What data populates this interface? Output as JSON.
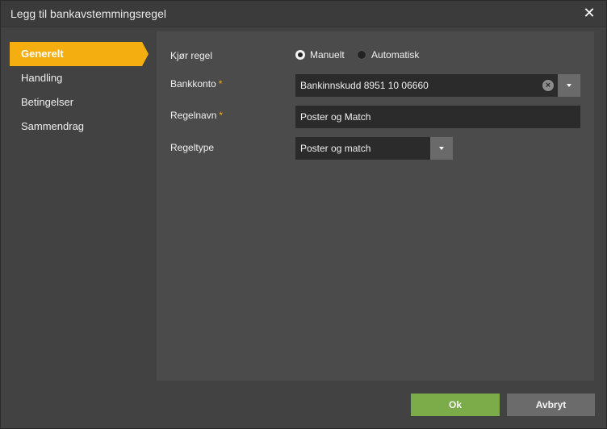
{
  "dialog": {
    "title": "Legg til bankavstemmingsregel",
    "close_glyph": "✕"
  },
  "sidebar": {
    "items": [
      {
        "label": "Generelt",
        "active": true
      },
      {
        "label": "Handling",
        "active": false
      },
      {
        "label": "Betingelser",
        "active": false
      },
      {
        "label": "Sammendrag",
        "active": false
      }
    ]
  },
  "form": {
    "run_rule": {
      "label": "Kjør regel",
      "options": [
        {
          "label": "Manuelt",
          "checked": true
        },
        {
          "label": "Automatisk",
          "checked": false
        }
      ]
    },
    "bank_account": {
      "label": "Bankkonto",
      "required_mark": "*",
      "value": "Bankinnskudd 8951 10 06660"
    },
    "rule_name": {
      "label": "Regelnavn",
      "required_mark": "*",
      "value": "Poster og Match"
    },
    "rule_type": {
      "label": "Regeltype",
      "value": "Poster og match"
    }
  },
  "footer": {
    "ok_label": "Ok",
    "cancel_label": "Avbryt"
  },
  "colors": {
    "accent": "#f4ae0f",
    "ok_button": "#7cab4a",
    "background": "#424242",
    "panel": "#4b4b4b",
    "field": "#2b2b2b"
  },
  "icons": [
    "close-icon",
    "clear-icon",
    "chevron-down-icon",
    "radio-icon"
  ]
}
